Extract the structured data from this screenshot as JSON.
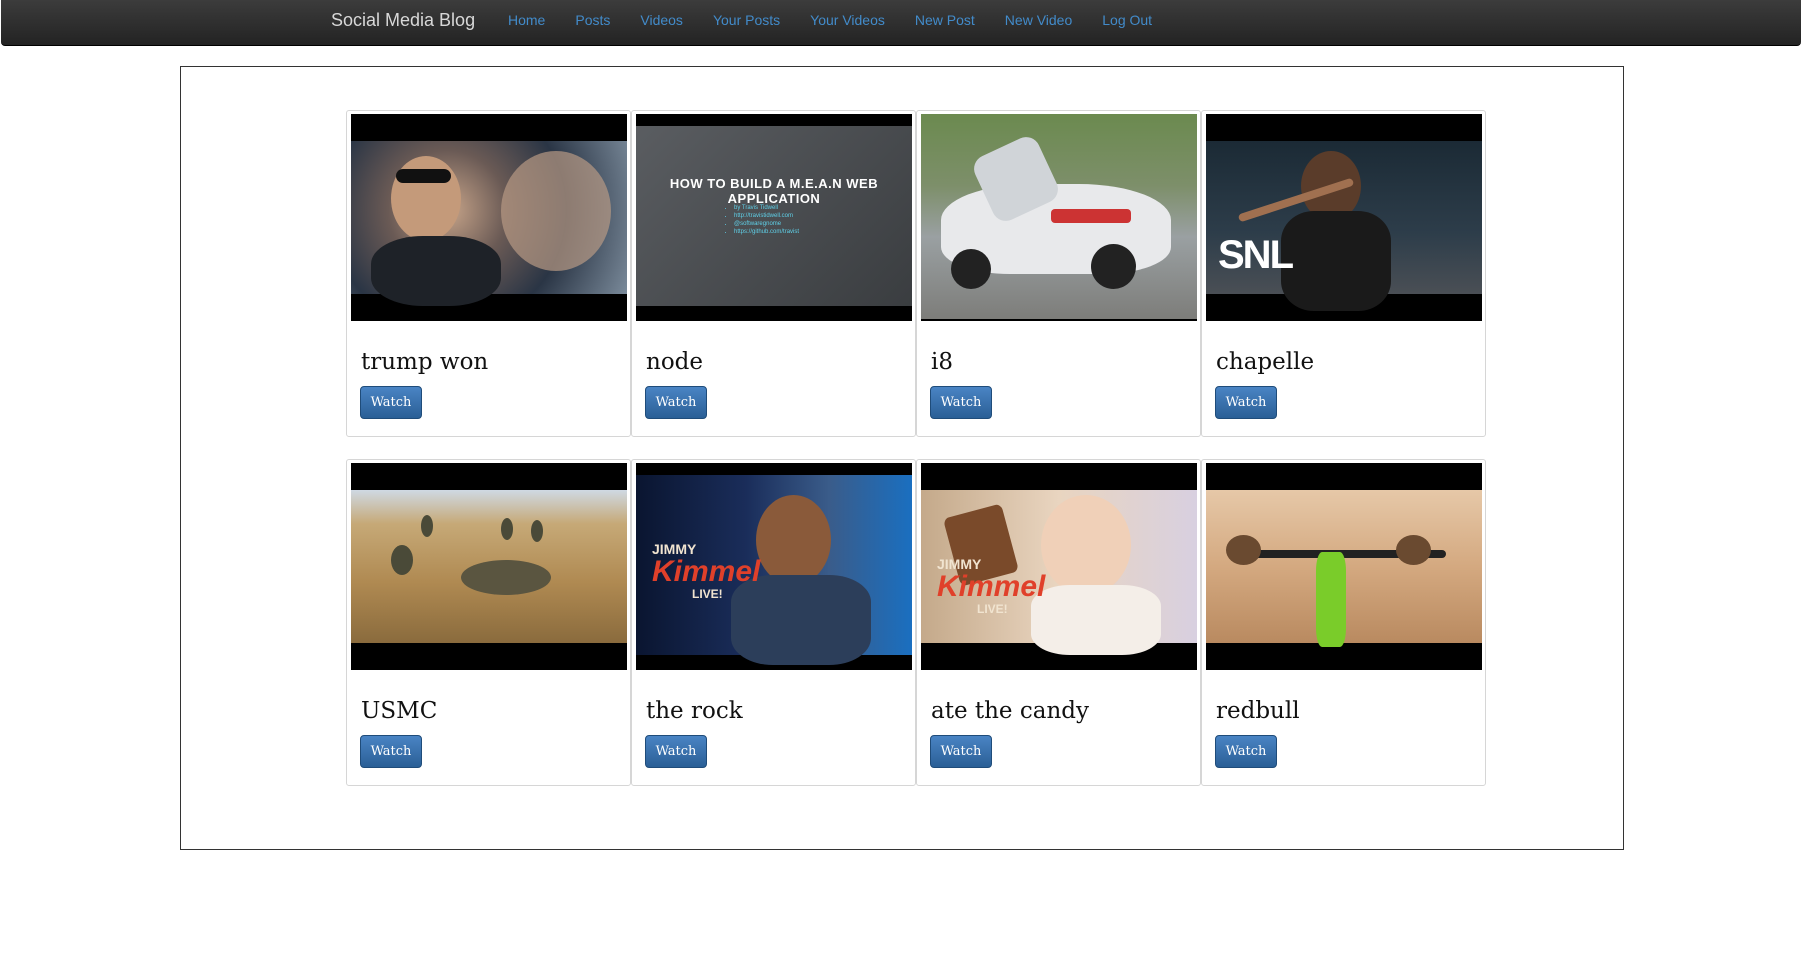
{
  "navbar": {
    "brand": "Social Media Blog",
    "links": [
      "Home",
      "Posts",
      "Videos",
      "Your Posts",
      "Your Videos",
      "New Post",
      "New Video",
      "Log Out"
    ]
  },
  "videos": [
    {
      "title": "trump won",
      "button": "Watch"
    },
    {
      "title": "node",
      "button": "Watch",
      "thumbnail_text": {
        "heading": "HOW TO BUILD A M.E.A.N WEB APPLICATION",
        "bullets": [
          "by Travis Tidwell",
          "http://travistidwell.com",
          "@softwaregnome",
          "https://github.com/travist"
        ]
      }
    },
    {
      "title": "i8",
      "button": "Watch"
    },
    {
      "title": "chapelle",
      "button": "Watch",
      "thumbnail_text": {
        "logo": "SNL"
      }
    },
    {
      "title": "USMC",
      "button": "Watch"
    },
    {
      "title": "the rock",
      "button": "Watch",
      "thumbnail_text": {
        "logo_top": "JIMMY",
        "logo_main": "Kimmel",
        "logo_bottom": "LIVE!"
      }
    },
    {
      "title": "ate the candy",
      "button": "Watch",
      "thumbnail_text": {
        "logo_top": "JIMMY",
        "logo_main": "Kimmel",
        "logo_bottom": "LIVE!"
      }
    },
    {
      "title": "redbull",
      "button": "Watch"
    }
  ],
  "colors": {
    "navbar_bg": "#2b2b2b",
    "nav_link": "#428bca",
    "button_bg": "#2e6aa8"
  }
}
